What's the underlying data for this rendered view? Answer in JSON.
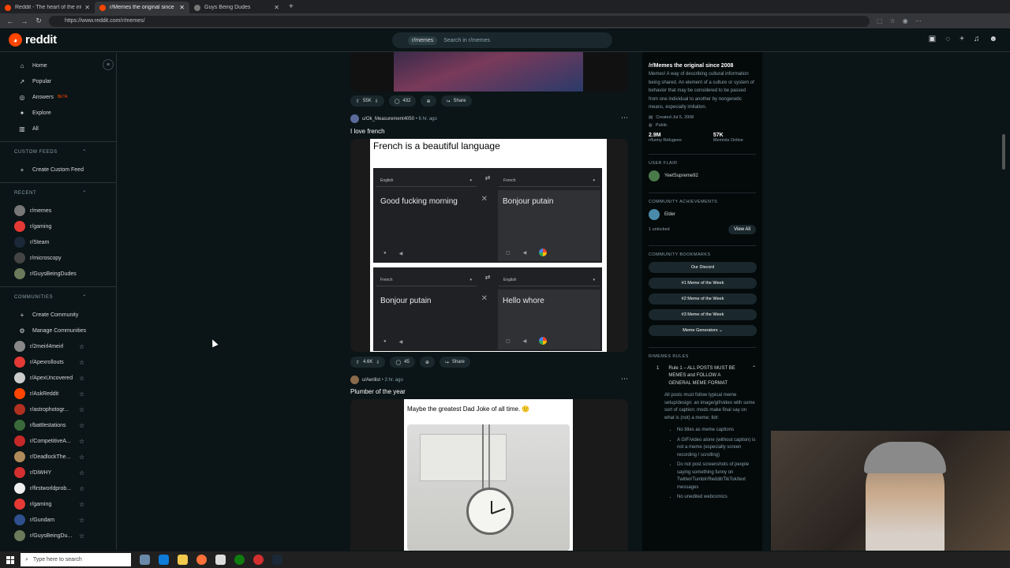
{
  "browser": {
    "tabs": [
      {
        "label": "Reddit - The heart of the internet",
        "active": false
      },
      {
        "label": "r/Memes the original since 2008",
        "active": true
      },
      {
        "label": "Guys Being Dudes",
        "active": false
      }
    ],
    "url": "https://www.reddit.com/r/memes/"
  },
  "header": {
    "logo_text": "reddit",
    "search_chip": "r/memes",
    "search_placeholder": "Search in r/memes"
  },
  "sidebar": {
    "main": [
      {
        "label": "Home",
        "icon": "home-icon",
        "glyph": "⌂"
      },
      {
        "label": "Popular",
        "icon": "popular-icon",
        "glyph": "↗"
      },
      {
        "label": "Answers",
        "icon": "answers-icon",
        "glyph": "◎"
      },
      {
        "label": "Explore",
        "icon": "explore-icon",
        "glyph": "✦"
      },
      {
        "label": "All",
        "icon": "all-icon",
        "glyph": "▥"
      }
    ],
    "answers_badge": "BETA",
    "custom_feeds_header": "CUSTOM FEEDS",
    "create_custom_feed": "Create Custom Feed",
    "recent_header": "RECENT",
    "recent": [
      {
        "label": "r/memes",
        "color": "#777777"
      },
      {
        "label": "r/gaming",
        "color": "#e53935"
      },
      {
        "label": "r/Steam",
        "color": "#1b2838"
      },
      {
        "label": "r/microscopy",
        "color": "#444444"
      },
      {
        "label": "r/GuysBeingDudes",
        "color": "#6a7a5a"
      }
    ],
    "communities_header": "COMMUNITIES",
    "create_community": "Create Community",
    "manage_communities": "Manage Communities",
    "communities": [
      {
        "label": "r/2meirl4meirl",
        "color": "#888888"
      },
      {
        "label": "r/Apexrollouts",
        "color": "#e53935"
      },
      {
        "label": "r/ApexUncovered",
        "color": "#cccccc"
      },
      {
        "label": "r/AskReddit",
        "color": "#ff4500"
      },
      {
        "label": "r/astrophotogr...",
        "color": "#b03020"
      },
      {
        "label": "r/battlestations",
        "color": "#3a6a3a"
      },
      {
        "label": "r/CompetitiveA...",
        "color": "#c62828"
      },
      {
        "label": "r/DeadlockThe...",
        "color": "#b08a5a"
      },
      {
        "label": "r/DiWHY",
        "color": "#d32f2f"
      },
      {
        "label": "r/firstworldprob...",
        "color": "#eeeeee"
      },
      {
        "label": "r/gaming",
        "color": "#e53935"
      },
      {
        "label": "r/Gundam",
        "color": "#2f4f8f"
      },
      {
        "label": "r/GuysBeingDu...",
        "color": "#6a7a5a"
      }
    ]
  },
  "posts": {
    "prev_actions": {
      "votes": "55K",
      "comments": "432",
      "share": "Share"
    },
    "post1": {
      "user": "u/Ok_Measurement4050",
      "time": "• 6 hr. ago",
      "title": "I love french",
      "meme_caption": "French is a beautiful language",
      "panel1": {
        "from": "English",
        "to": "French",
        "source": "Good fucking morning",
        "result": "Bonjour putain"
      },
      "panel2": {
        "from": "French",
        "to": "English",
        "source": "Bonjour putain",
        "result": "Hello whore"
      },
      "votes": "4.6K",
      "comments": "45",
      "share": "Share"
    },
    "post2": {
      "user": "u/Aerilist",
      "time": "• 3 hr. ago",
      "title": "Plumber of the year",
      "meme_caption": "Maybe the greatest Dad Joke of all time. 🙂"
    }
  },
  "right_sidebar": {
    "title": "/r/Memes the original since 2008",
    "description": "Memes! A way of describing cultural information being shared. An element of a culture or system of behavior that may be considered to be passed from one individual to another by nongenetic means, especially imitation.",
    "created": "Created Jul 5, 2008",
    "visibility": "Public",
    "members": "2.9M",
    "members_label": "r/funny Refugees",
    "online": "57K",
    "online_label": "Memists Online",
    "user_flair_header": "USER FLAIR",
    "user_flair_name": "YeetSupreme92",
    "achievements_header": "COMMUNITY ACHIEVEMENTS",
    "achievement_name": "Elder",
    "unlocked": "1 unlocked",
    "view_all": "View All",
    "bookmarks_header": "COMMUNITY BOOKMARKS",
    "bookmarks": [
      "Our Discord",
      "#1 Meme of the Week",
      "#2 Meme of the Week",
      "#3 Meme of the Week",
      "Meme Generators ⌄"
    ],
    "rules_header": "R/MEMES RULES",
    "rule1_num": "1",
    "rule1_title": "Rule 1 – ALL POSTS MUST BE MEMES and FOLLOW A GENERAL MEME FORMAT",
    "rule1_body": "All posts must follow typical meme setup/design: an image/gif/video with some sort of caption; mods make final say on what is (not) a meme; tldr:",
    "rule1_bullets": [
      "No titles as meme captions",
      "A GIF/video alone (without caption) is not a meme (especially screen recording / scrolling)",
      "Do not post screenshots of people saying something funny on Twitter/Tumblr/Reddit/TikTok/text messages",
      "No unedited webcomics"
    ]
  },
  "taskbar": {
    "search_placeholder": "Type here to search"
  }
}
